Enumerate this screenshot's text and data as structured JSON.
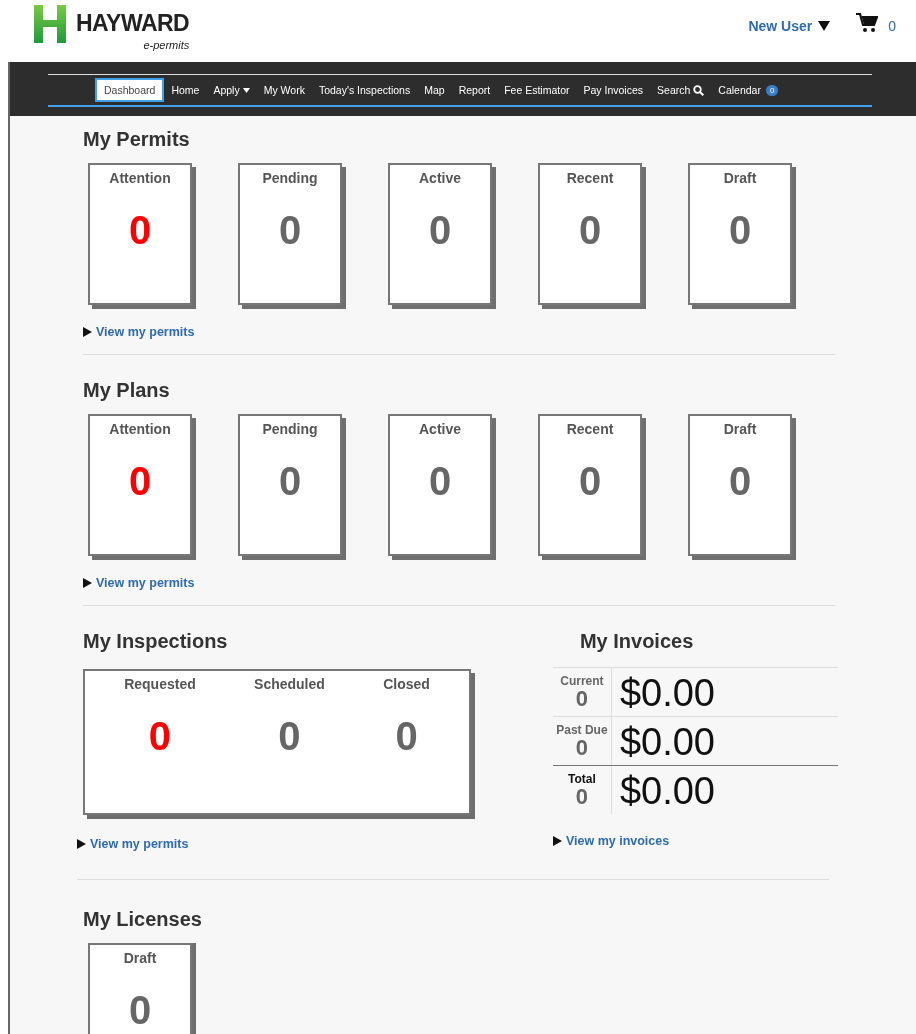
{
  "header": {
    "brand": "HAYWARD",
    "subbrand": "e-permits",
    "user": "New User",
    "cart_count": "0"
  },
  "nav": [
    {
      "label": "Dashboard",
      "selected": true
    },
    {
      "label": "Home",
      "selected": false
    },
    {
      "label": "Apply",
      "selected": false,
      "kind": "dropdown"
    },
    {
      "label": "My Work",
      "selected": false
    },
    {
      "label": "Today's Inspections",
      "selected": false
    },
    {
      "label": "Map",
      "selected": false
    },
    {
      "label": "Report",
      "selected": false
    },
    {
      "label": "Fee Estimator",
      "selected": false
    },
    {
      "label": "Pay Invoices",
      "selected": false
    },
    {
      "label": "Search",
      "selected": false,
      "kind": "search"
    },
    {
      "label": "Calendar",
      "selected": false,
      "kind": "badge",
      "badge": "0"
    }
  ],
  "permits": {
    "title": "My Permits",
    "cards": [
      {
        "label": "Attention",
        "count": "0",
        "alert": true
      },
      {
        "label": "Pending",
        "count": "0",
        "alert": false
      },
      {
        "label": "Active",
        "count": "0",
        "alert": false
      },
      {
        "label": "Recent",
        "count": "0",
        "alert": false
      },
      {
        "label": "Draft",
        "count": "0",
        "alert": false
      }
    ],
    "link": "View my permits"
  },
  "plans": {
    "title": "My Plans",
    "cards": [
      {
        "label": "Attention",
        "count": "0",
        "alert": true
      },
      {
        "label": "Pending",
        "count": "0",
        "alert": false
      },
      {
        "label": "Active",
        "count": "0",
        "alert": false
      },
      {
        "label": "Recent",
        "count": "0",
        "alert": false
      },
      {
        "label": "Draft",
        "count": "0",
        "alert": false
      }
    ],
    "link": "View my permits"
  },
  "inspections": {
    "title": "My Inspections",
    "columns": [
      {
        "label": "Requested",
        "count": "0",
        "alert": true
      },
      {
        "label": "Scheduled",
        "count": "0",
        "alert": false
      },
      {
        "label": "Closed",
        "count": "0",
        "alert": false
      }
    ],
    "link": "View my permits"
  },
  "invoices": {
    "title": "My Invoices",
    "rows": [
      {
        "label": "Current",
        "count": "0",
        "amount": "$0.00",
        "total": false
      },
      {
        "label": "Past Due",
        "count": "0",
        "amount": "$0.00",
        "total": false
      },
      {
        "label": "Total",
        "count": "0",
        "amount": "$0.00",
        "total": true
      }
    ],
    "link": "View my invoices"
  },
  "licenses": {
    "title": "My Licenses",
    "cards": [
      {
        "label": "Draft",
        "count": "0",
        "alert": false
      }
    ]
  }
}
